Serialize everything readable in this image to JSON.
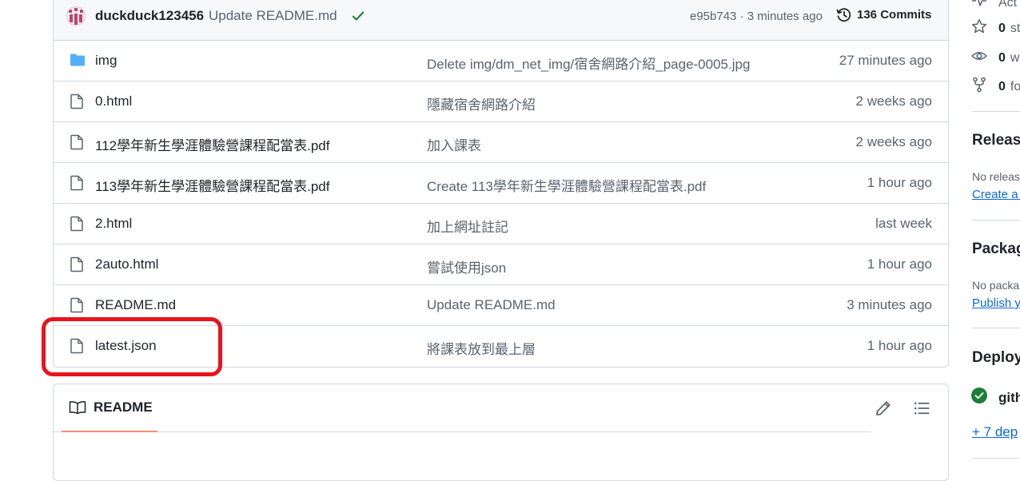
{
  "latest_commit": {
    "author": "duckduck123456",
    "message": "Update README.md",
    "sha_time": "e95b743 · 3 minutes ago",
    "commits_label": "136 Commits"
  },
  "files": [
    {
      "type": "folder",
      "name": "img",
      "message": "Delete img/dm_net_img/宿舍網路介紹_page-0005.jpg",
      "time": "27 minutes ago"
    },
    {
      "type": "file",
      "name": "0.html",
      "message": "隱藏宿舍網路介紹",
      "time": "2 weeks ago"
    },
    {
      "type": "file",
      "name": "112學年新生學涯體驗營課程配當表.pdf",
      "message": "加入課表",
      "time": "2 weeks ago"
    },
    {
      "type": "file",
      "name": "113學年新生學涯體驗營課程配當表.pdf",
      "message": "Create 113學年新生學涯體驗營課程配當表.pdf",
      "time": "1 hour ago"
    },
    {
      "type": "file",
      "name": "2.html",
      "message": "加上網址註記",
      "time": "last week"
    },
    {
      "type": "file",
      "name": "2auto.html",
      "message": "嘗試使用json",
      "time": "1 hour ago"
    },
    {
      "type": "file",
      "name": "README.md",
      "message": "Update README.md",
      "time": "3 minutes ago"
    },
    {
      "type": "file",
      "name": "latest.json",
      "message": "將課表放到最上層",
      "time": "1 hour ago"
    }
  ],
  "readme": {
    "tab_label": "README"
  },
  "sidebar": {
    "top_partial": "Act",
    "stars": {
      "count": "0",
      "label": "st"
    },
    "watching": {
      "count": "0",
      "label": "w"
    },
    "forks": {
      "count": "0",
      "label": "fo"
    },
    "releases_heading": "Releas",
    "releases_empty": "No releas",
    "releases_link": "Create a n",
    "packages_heading": "Packag",
    "packages_empty": "No packa",
    "packages_link": "Publish yo",
    "deployments_heading": "Deploy",
    "deployment_item": "gith",
    "deployments_more": "+ 7 dep"
  },
  "colors": {
    "highlight": "#e8141e",
    "link": "#0969da",
    "success": "#1a7f37",
    "folder": "#54aeff"
  }
}
